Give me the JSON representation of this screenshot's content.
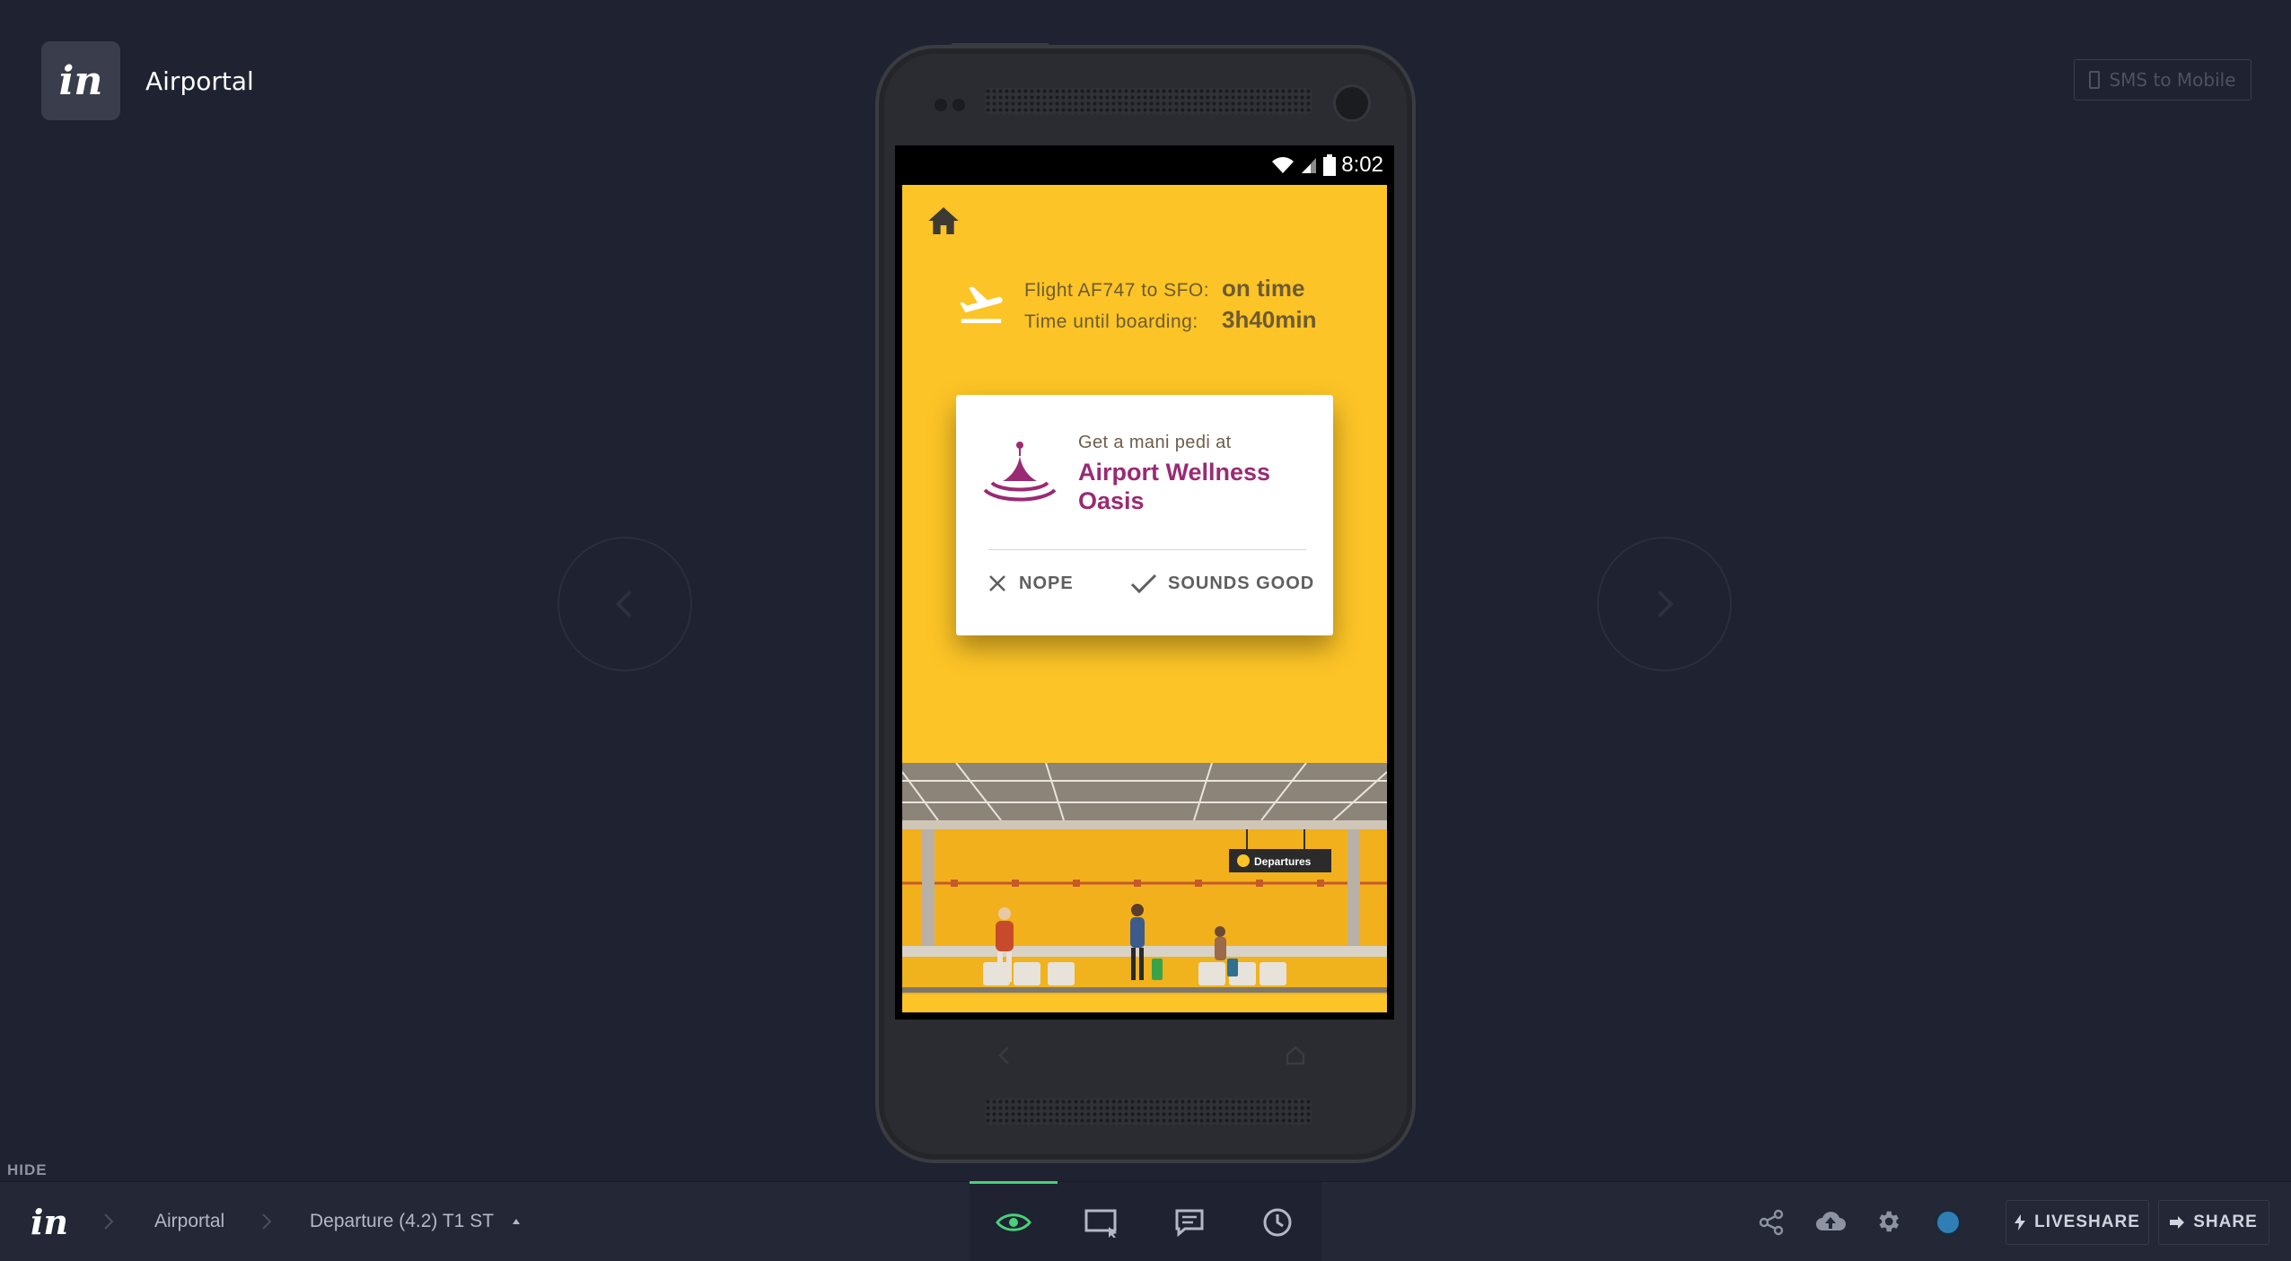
{
  "project": {
    "logo_text": "in",
    "title": "Airportal"
  },
  "header": {
    "sms_label": "SMS to Mobile"
  },
  "device": {
    "status_time": "8:02"
  },
  "app": {
    "flight_label": "Flight AF747 to SFO:",
    "flight_status": "on time",
    "boarding_label": "Time until boarding:",
    "boarding_time": "3h40min",
    "card": {
      "subtitle": "Get a mani pedi at",
      "title": "Airport Wellness Oasis",
      "nope_label": "NOPE",
      "accept_label": "SOUNDS GOOD"
    },
    "illustration_sign": "Departures"
  },
  "toolbar": {
    "hide_label": "HIDE",
    "logo_text": "in",
    "breadcrumb_project": "Airportal",
    "breadcrumb_screen": "Departure (4.2) T1 ST",
    "liveshare_label": "LIVESHARE",
    "share_label": "SHARE",
    "mode_tools": [
      "preview-icon",
      "build-icon",
      "comment-icon",
      "history-icon"
    ],
    "right_tools": [
      "share-network-icon",
      "sync-cloud-icon",
      "settings-icon",
      "user-status-icon"
    ]
  },
  "colors": {
    "background": "#1f2230",
    "app_yellow": "#fcc426",
    "brand_plum": "#9a2a73",
    "preview_active": "#4ad07b",
    "status_dot": "#2f7fb5"
  }
}
